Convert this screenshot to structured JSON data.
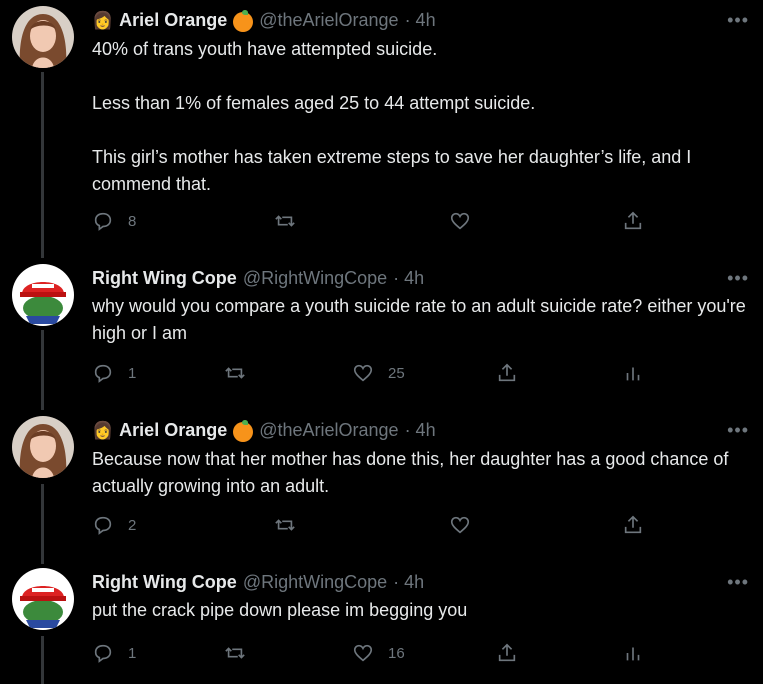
{
  "tweets": [
    {
      "name": "Ariel Orange",
      "handle": "@theArielOrange",
      "time": "· 4h",
      "text": "40% of trans youth have attempted suicide.\n\nLess than 1% of females aged 25 to  44 attempt suicide.\n\nThis girl’s mother has taken extreme steps to save her daughter’s life, and I commend that.",
      "replies": "8",
      "retweets": "",
      "likes": ""
    },
    {
      "name": "Right Wing Cope",
      "handle": "@RightWingCope",
      "time": "· 4h",
      "text": "why would you compare a youth suicide rate to an adult suicide rate? either you're high or I am",
      "replies": "1",
      "retweets": "",
      "likes": "25"
    },
    {
      "name": "Ariel Orange",
      "handle": "@theArielOrange",
      "time": "· 4h",
      "text": "Because now that her mother has done this, her daughter has a good chance of actually growing into an adult.",
      "replies": "2",
      "retweets": "",
      "likes": ""
    },
    {
      "name": "Right Wing Cope",
      "handle": "@RightWingCope",
      "time": "· 4h",
      "text": "put the crack pipe down please im begging you",
      "replies": "1",
      "retweets": "",
      "likes": "16"
    }
  ],
  "more_label": "•••",
  "colors": {
    "background": "#000000",
    "text": "#e7e9ea",
    "muted": "#6e767d",
    "accent_orange": "#f7931a"
  }
}
